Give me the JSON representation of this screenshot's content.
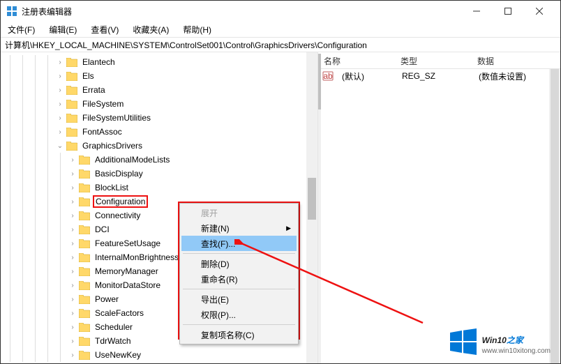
{
  "window": {
    "title": "注册表编辑器"
  },
  "menu": {
    "file": "文件(F)",
    "edit": "编辑(E)",
    "view": "查看(V)",
    "favorites": "收藏夹(A)",
    "help": "帮助(H)"
  },
  "address": "计算机\\HKEY_LOCAL_MACHINE\\SYSTEM\\ControlSet001\\Control\\GraphicsDrivers\\Configuration",
  "tree": {
    "items": [
      {
        "indent": 4,
        "twisty": ">",
        "label": "Elantech"
      },
      {
        "indent": 4,
        "twisty": ">",
        "label": "Els"
      },
      {
        "indent": 4,
        "twisty": ">",
        "label": "Errata"
      },
      {
        "indent": 4,
        "twisty": ">",
        "label": "FileSystem"
      },
      {
        "indent": 4,
        "twisty": ">",
        "label": "FileSystemUtilities"
      },
      {
        "indent": 4,
        "twisty": ">",
        "label": "FontAssoc"
      },
      {
        "indent": 4,
        "twisty": "v",
        "label": "GraphicsDrivers"
      },
      {
        "indent": 5,
        "twisty": ">",
        "label": "AdditionalModeLists"
      },
      {
        "indent": 5,
        "twisty": ">",
        "label": "BasicDisplay"
      },
      {
        "indent": 5,
        "twisty": ">",
        "label": "BlockList"
      },
      {
        "indent": 5,
        "twisty": ">",
        "label": "Configuration",
        "highlight": true
      },
      {
        "indent": 5,
        "twisty": ">",
        "label": "Connectivity"
      },
      {
        "indent": 5,
        "twisty": ">",
        "label": "DCI"
      },
      {
        "indent": 5,
        "twisty": ">",
        "label": "FeatureSetUsage"
      },
      {
        "indent": 5,
        "twisty": ">",
        "label": "InternalMonBrightness"
      },
      {
        "indent": 5,
        "twisty": ">",
        "label": "MemoryManager"
      },
      {
        "indent": 5,
        "twisty": ">",
        "label": "MonitorDataStore"
      },
      {
        "indent": 5,
        "twisty": ">",
        "label": "Power"
      },
      {
        "indent": 5,
        "twisty": ">",
        "label": "ScaleFactors"
      },
      {
        "indent": 5,
        "twisty": ">",
        "label": "Scheduler"
      },
      {
        "indent": 5,
        "twisty": ">",
        "label": "TdrWatch"
      },
      {
        "indent": 5,
        "twisty": ">",
        "label": "UseNewKey"
      }
    ]
  },
  "list": {
    "cols": {
      "name": "名称",
      "type": "类型",
      "data": "数据"
    },
    "rows": [
      {
        "name": "(默认)",
        "type": "REG_SZ",
        "data": "(数值未设置)"
      }
    ]
  },
  "ctx": {
    "expand": "展开",
    "new": "新建(N)",
    "find": "查找(F)...",
    "delete": "删除(D)",
    "rename": "重命名(R)",
    "export": "导出(E)",
    "permissions": "权限(P)...",
    "copykeyname": "复制项名称(C)"
  },
  "watermark": {
    "main1": "Win10",
    "main2": "之家",
    "sub": "www.win10xitong.com"
  }
}
